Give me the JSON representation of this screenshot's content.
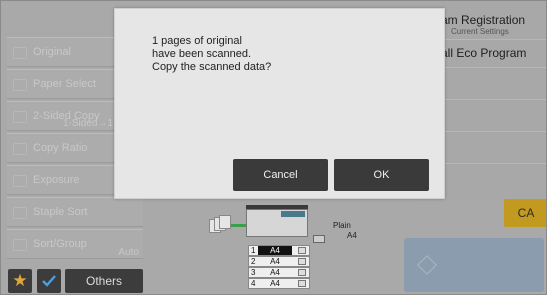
{
  "left_menu": {
    "items": [
      {
        "label": "Original",
        "sub": ""
      },
      {
        "label": "Paper Select",
        "sub": ""
      },
      {
        "label": "2-Sided Copy",
        "sub": "1-Sided→1"
      },
      {
        "label": "Copy Ratio",
        "sub": ""
      },
      {
        "label": "Exposure",
        "sub": ""
      },
      {
        "label": "Staple Sort",
        "sub": ""
      },
      {
        "label": "Sort/Group",
        "sub": "Auto"
      }
    ]
  },
  "bottom_bar": {
    "star_glyph": "★",
    "others_label": "Others"
  },
  "right_panel": {
    "program_title": "am Registration",
    "program_sub": "Current Settings",
    "eco_label": "all Eco Program",
    "ca_label": "CA"
  },
  "copier": {
    "plain_label": "Plain",
    "bypass_size": "A4",
    "trays": [
      {
        "num": "1",
        "size": "A4",
        "selected": true
      },
      {
        "num": "2",
        "size": "A4",
        "selected": false
      },
      {
        "num": "3",
        "size": "A4",
        "selected": false
      },
      {
        "num": "4",
        "size": "A4",
        "selected": false
      }
    ]
  },
  "dialog": {
    "message_lines": [
      "1 pages of original",
      "have been scanned.",
      "Copy the scanned data?"
    ],
    "cancel_label": "Cancel",
    "ok_label": "OK"
  },
  "colors": {
    "ca_button": "#c29a20",
    "start_button": "#8a9cae",
    "dialog_bg": "#e6e6e6",
    "dialog_button": "#3a3a3a"
  }
}
